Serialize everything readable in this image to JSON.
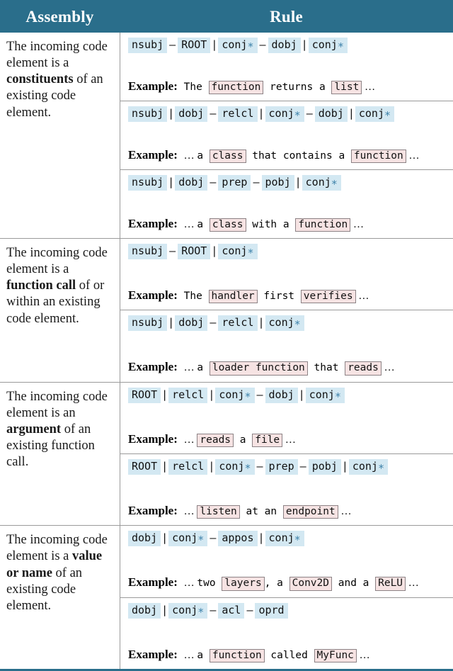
{
  "header": {
    "assembly_label": "Assembly",
    "rule_label": "Rule",
    "bg_color": "#2a6e8b",
    "text_color": "#ffffff"
  },
  "colors": {
    "token_bg": "#d3e8f2",
    "token_asterisk": "#3a7fa8",
    "code_chip_bg": "#f6e3e3",
    "code_chip_border": "#8c8285",
    "grid_line": "#9a9a9a"
  },
  "example_label": "Example:",
  "ellipsis": "…",
  "rows": [
    {
      "assembly_prefix": "The incoming code element is a ",
      "assembly_bold": "constituents",
      "assembly_suffix": " of an existing code element.",
      "subrows": [
        {
          "pattern": [
            {
              "type": "tok",
              "text": "nsubj"
            },
            {
              "type": "dash",
              "text": "–"
            },
            {
              "type": "tok",
              "text": "ROOT"
            },
            {
              "type": "sep",
              "text": "|"
            },
            {
              "type": "tok",
              "text": "conj",
              "star": true
            },
            {
              "type": "dash",
              "text": "–"
            },
            {
              "type": "tok",
              "text": "dobj"
            },
            {
              "type": "sep",
              "text": "|"
            },
            {
              "type": "tok",
              "text": "conj",
              "star": true
            }
          ],
          "example": [
            {
              "type": "text",
              "text": "The "
            },
            {
              "type": "chip",
              "text": "function"
            },
            {
              "type": "text",
              "text": " returns a "
            },
            {
              "type": "chip",
              "text": "list"
            },
            {
              "type": "ell",
              "text": " …"
            }
          ]
        },
        {
          "pattern": [
            {
              "type": "tok",
              "text": "nsubj"
            },
            {
              "type": "sep",
              "text": "|"
            },
            {
              "type": "tok",
              "text": "dobj"
            },
            {
              "type": "dash",
              "text": "–"
            },
            {
              "type": "tok",
              "text": "relcl"
            },
            {
              "type": "sep",
              "text": "|"
            },
            {
              "type": "tok",
              "text": "conj",
              "star": true
            },
            {
              "type": "dash",
              "text": "–"
            },
            {
              "type": "tok",
              "text": "dobj"
            },
            {
              "type": "sep",
              "text": "|"
            },
            {
              "type": "tok",
              "text": "conj",
              "star": true
            }
          ],
          "example": [
            {
              "type": "ell",
              "text": "… "
            },
            {
              "type": "text",
              "text": "a "
            },
            {
              "type": "chip",
              "text": "class"
            },
            {
              "type": "text",
              "text": " that contains a "
            },
            {
              "type": "chip",
              "text": "function"
            },
            {
              "type": "ell",
              "text": " …"
            }
          ]
        },
        {
          "pattern": [
            {
              "type": "tok",
              "text": "nsubj"
            },
            {
              "type": "sep",
              "text": "|"
            },
            {
              "type": "tok",
              "text": "dobj"
            },
            {
              "type": "dash",
              "text": "–"
            },
            {
              "type": "tok",
              "text": "prep"
            },
            {
              "type": "dash",
              "text": "–"
            },
            {
              "type": "tok",
              "text": "pobj"
            },
            {
              "type": "sep",
              "text": "|"
            },
            {
              "type": "tok",
              "text": "conj",
              "star": true
            }
          ],
          "example": [
            {
              "type": "ell",
              "text": "… "
            },
            {
              "type": "text",
              "text": "a "
            },
            {
              "type": "chip",
              "text": "class"
            },
            {
              "type": "text",
              "text": " with a "
            },
            {
              "type": "chip",
              "text": "function"
            },
            {
              "type": "ell",
              "text": " …"
            }
          ]
        }
      ]
    },
    {
      "assembly_prefix": "The incoming code element is a ",
      "assembly_bold": "function call",
      "assembly_suffix": " of or within an existing code element.",
      "subrows": [
        {
          "pattern": [
            {
              "type": "tok",
              "text": "nsubj"
            },
            {
              "type": "dash",
              "text": "–"
            },
            {
              "type": "tok",
              "text": "ROOT"
            },
            {
              "type": "sep",
              "text": "|"
            },
            {
              "type": "tok",
              "text": "conj",
              "star": true
            }
          ],
          "example": [
            {
              "type": "text",
              "text": "The "
            },
            {
              "type": "chip",
              "text": "handler"
            },
            {
              "type": "text",
              "text": " first "
            },
            {
              "type": "chip",
              "text": "verifies"
            },
            {
              "type": "ell",
              "text": " …"
            }
          ]
        },
        {
          "pattern": [
            {
              "type": "tok",
              "text": "nsubj"
            },
            {
              "type": "sep",
              "text": "|"
            },
            {
              "type": "tok",
              "text": "dobj"
            },
            {
              "type": "dash",
              "text": "–"
            },
            {
              "type": "tok",
              "text": "relcl"
            },
            {
              "type": "sep",
              "text": "|"
            },
            {
              "type": "tok",
              "text": "conj",
              "star": true
            }
          ],
          "example": [
            {
              "type": "ell",
              "text": "… "
            },
            {
              "type": "text",
              "text": "a "
            },
            {
              "type": "chip",
              "text": "loader function"
            },
            {
              "type": "text",
              "text": " that "
            },
            {
              "type": "chip",
              "text": "reads"
            },
            {
              "type": "ell",
              "text": " …"
            }
          ]
        }
      ]
    },
    {
      "assembly_prefix": "The incoming code element is an ",
      "assembly_bold": "argument",
      "assembly_suffix": " of an existing function call.",
      "subrows": [
        {
          "pattern": [
            {
              "type": "tok",
              "text": "ROOT"
            },
            {
              "type": "sep",
              "text": "|"
            },
            {
              "type": "tok",
              "text": "relcl"
            },
            {
              "type": "sep",
              "text": "|"
            },
            {
              "type": "tok",
              "text": "conj",
              "star": true
            },
            {
              "type": "dash",
              "text": "–"
            },
            {
              "type": "tok",
              "text": "dobj"
            },
            {
              "type": "sep",
              "text": "|"
            },
            {
              "type": "tok",
              "text": "conj",
              "star": true
            }
          ],
          "example": [
            {
              "type": "ell",
              "text": "… "
            },
            {
              "type": "chip",
              "text": "reads"
            },
            {
              "type": "text",
              "text": " a "
            },
            {
              "type": "chip",
              "text": "file"
            },
            {
              "type": "ell",
              "text": " …"
            }
          ]
        },
        {
          "pattern": [
            {
              "type": "tok",
              "text": "ROOT"
            },
            {
              "type": "sep",
              "text": "|"
            },
            {
              "type": "tok",
              "text": "relcl"
            },
            {
              "type": "sep",
              "text": "|"
            },
            {
              "type": "tok",
              "text": "conj",
              "star": true
            },
            {
              "type": "dash",
              "text": "–"
            },
            {
              "type": "tok",
              "text": "prep"
            },
            {
              "type": "dash",
              "text": "–"
            },
            {
              "type": "tok",
              "text": "pobj"
            },
            {
              "type": "sep",
              "text": "|"
            },
            {
              "type": "tok",
              "text": "conj",
              "star": true
            }
          ],
          "example": [
            {
              "type": "ell",
              "text": "… "
            },
            {
              "type": "chip",
              "text": "listen"
            },
            {
              "type": "text",
              "text": " at an "
            },
            {
              "type": "chip",
              "text": "endpoint"
            },
            {
              "type": "ell",
              "text": " …"
            }
          ]
        }
      ]
    },
    {
      "assembly_prefix": "The incoming code element is a ",
      "assembly_bold": "value or name",
      "assembly_suffix": " of an existing code element.",
      "subrows": [
        {
          "pattern": [
            {
              "type": "tok",
              "text": "dobj"
            },
            {
              "type": "sep",
              "text": "|"
            },
            {
              "type": "tok",
              "text": "conj",
              "star": true
            },
            {
              "type": "dash",
              "text": "–"
            },
            {
              "type": "tok",
              "text": "appos"
            },
            {
              "type": "sep",
              "text": "|"
            },
            {
              "type": "tok",
              "text": "conj",
              "star": true
            }
          ],
          "example": [
            {
              "type": "ell",
              "text": "… "
            },
            {
              "type": "text",
              "text": "two "
            },
            {
              "type": "chip",
              "text": "layers"
            },
            {
              "type": "text",
              "text": ",  a "
            },
            {
              "type": "chip",
              "text": "Conv2D"
            },
            {
              "type": "text",
              "text": " and a "
            },
            {
              "type": "chip",
              "text": "ReLU"
            },
            {
              "type": "ell",
              "text": " …"
            }
          ]
        },
        {
          "pattern": [
            {
              "type": "tok",
              "text": "dobj"
            },
            {
              "type": "sep",
              "text": "|"
            },
            {
              "type": "tok",
              "text": "conj",
              "star": true
            },
            {
              "type": "dash",
              "text": "–"
            },
            {
              "type": "tok",
              "text": "acl"
            },
            {
              "type": "dash",
              "text": "–"
            },
            {
              "type": "tok",
              "text": "oprd"
            }
          ],
          "example": [
            {
              "type": "ell",
              "text": "… "
            },
            {
              "type": "text",
              "text": "a "
            },
            {
              "type": "chip",
              "text": "function"
            },
            {
              "type": "text",
              "text": " called "
            },
            {
              "type": "chip",
              "text": "MyFunc"
            },
            {
              "type": "ell",
              "text": " …"
            }
          ]
        }
      ]
    }
  ]
}
